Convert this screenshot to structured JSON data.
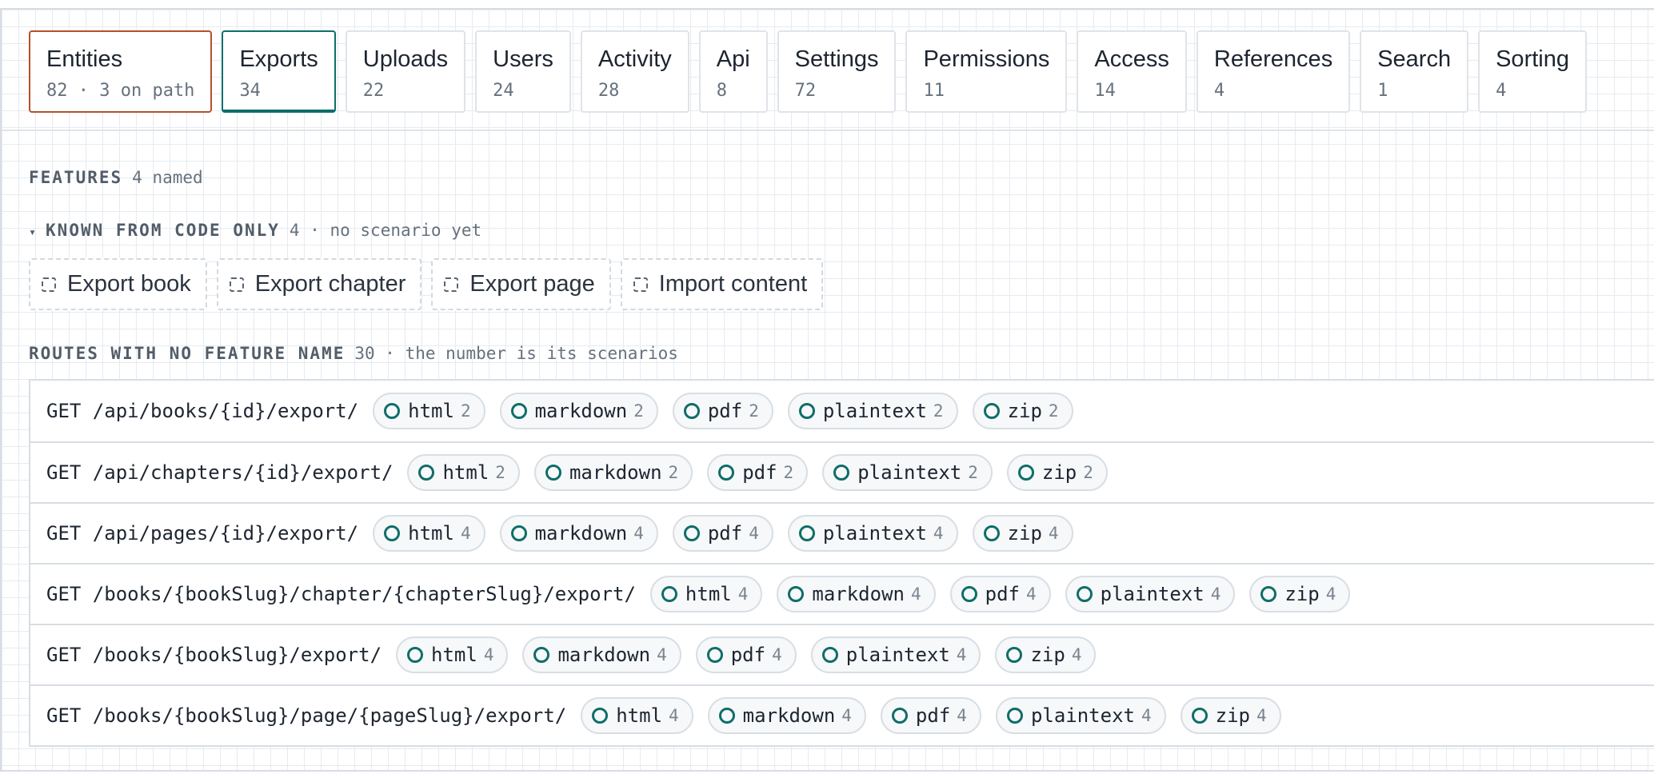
{
  "tabs": [
    {
      "name": "Entities",
      "count": "82 · 3 on path"
    },
    {
      "name": "Exports",
      "count": "34"
    },
    {
      "name": "Uploads",
      "count": "22"
    },
    {
      "name": "Users",
      "count": "24"
    },
    {
      "name": "Activity",
      "count": "28"
    },
    {
      "name": "Api",
      "count": "8"
    },
    {
      "name": "Settings",
      "count": "72"
    },
    {
      "name": "Permissions",
      "count": "11"
    },
    {
      "name": "Access",
      "count": "14"
    },
    {
      "name": "References",
      "count": "4"
    },
    {
      "name": "Search",
      "count": "1"
    },
    {
      "name": "Sorting",
      "count": "4"
    }
  ],
  "features": {
    "label": "FEATURES",
    "meta": "4 named"
  },
  "known": {
    "caret": "▾",
    "label": "KNOWN FROM CODE ONLY",
    "meta": "4 · no scenario yet",
    "items": [
      "Export book",
      "Export chapter",
      "Export page",
      "Import content"
    ]
  },
  "unnamed": {
    "label": "ROUTES WITH NO FEATURE NAME",
    "meta": "30 · the number is its scenarios"
  },
  "routes": [
    {
      "path": "GET /api/books/{id}/export/",
      "formats": [
        {
          "name": "html",
          "count": "2"
        },
        {
          "name": "markdown",
          "count": "2"
        },
        {
          "name": "pdf",
          "count": "2"
        },
        {
          "name": "plaintext",
          "count": "2"
        },
        {
          "name": "zip",
          "count": "2"
        }
      ]
    },
    {
      "path": "GET /api/chapters/{id}/export/",
      "formats": [
        {
          "name": "html",
          "count": "2"
        },
        {
          "name": "markdown",
          "count": "2"
        },
        {
          "name": "pdf",
          "count": "2"
        },
        {
          "name": "plaintext",
          "count": "2"
        },
        {
          "name": "zip",
          "count": "2"
        }
      ]
    },
    {
      "path": "GET /api/pages/{id}/export/",
      "formats": [
        {
          "name": "html",
          "count": "4"
        },
        {
          "name": "markdown",
          "count": "4"
        },
        {
          "name": "pdf",
          "count": "4"
        },
        {
          "name": "plaintext",
          "count": "4"
        },
        {
          "name": "zip",
          "count": "4"
        }
      ]
    },
    {
      "path": "GET /books/{bookSlug}/chapter/{chapterSlug}/export/",
      "formats": [
        {
          "name": "html",
          "count": "4"
        },
        {
          "name": "markdown",
          "count": "4"
        },
        {
          "name": "pdf",
          "count": "4"
        },
        {
          "name": "plaintext",
          "count": "4"
        },
        {
          "name": "zip",
          "count": "4"
        }
      ]
    },
    {
      "path": "GET /books/{bookSlug}/export/",
      "formats": [
        {
          "name": "html",
          "count": "4"
        },
        {
          "name": "markdown",
          "count": "4"
        },
        {
          "name": "pdf",
          "count": "4"
        },
        {
          "name": "plaintext",
          "count": "4"
        },
        {
          "name": "zip",
          "count": "4"
        }
      ]
    },
    {
      "path": "GET /books/{bookSlug}/page/{pageSlug}/export/",
      "formats": [
        {
          "name": "html",
          "count": "4"
        },
        {
          "name": "markdown",
          "count": "4"
        },
        {
          "name": "pdf",
          "count": "4"
        },
        {
          "name": "plaintext",
          "count": "4"
        },
        {
          "name": "zip",
          "count": "4"
        }
      ]
    }
  ]
}
